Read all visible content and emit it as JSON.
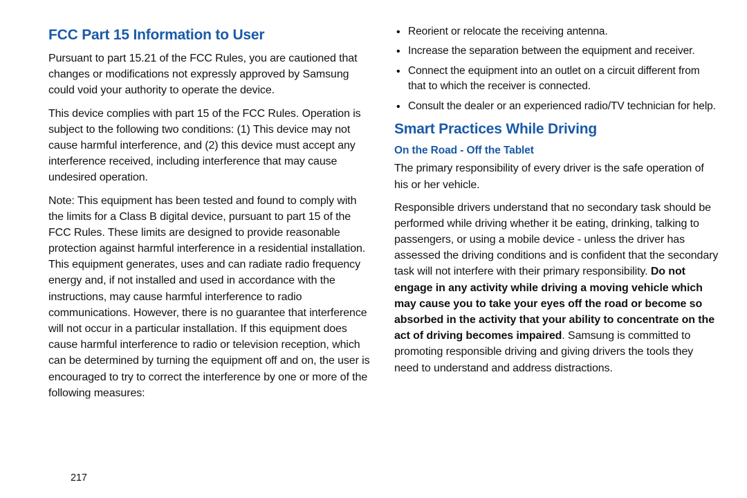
{
  "left": {
    "heading": "FCC Part 15 Information to User",
    "p1": "Pursuant to part 15.21 of the FCC Rules, you are cautioned that changes or modifications not expressly approved by Samsung could void your authority to operate the device.",
    "p2": "This device complies with part 15 of the FCC Rules. Operation is subject to the following two conditions: (1) This device may not cause harmful interference, and (2) this device must accept any interference received, including interference that may cause undesired operation.",
    "p3": "Note: This equipment has been tested and found to comply with the limits for a Class B digital device, pursuant to part 15 of the FCC Rules. These limits are designed to provide reasonable protection against harmful interference in a residential installation. This equipment generates, uses and can radiate radio frequency energy and, if not installed and used in accordance with the instructions, may cause harmful interference to radio communications. However, there is no guarantee that interference will not occur in a particular installation. If this equipment does cause harmful interference to radio or television reception, which can be determined by turning the equipment off and on, the user is encouraged to try to correct the interference by one or more of the following measures:"
  },
  "right": {
    "bullets": [
      "Reorient or relocate the receiving antenna.",
      "Increase the separation between the equipment and receiver.",
      "Connect the equipment into an outlet on a circuit different from that to which the receiver is connected.",
      "Consult the dealer or an experienced radio/TV technician for help."
    ],
    "heading2": "Smart Practices While Driving",
    "subheading": "On the Road - Off the Tablet",
    "p_primary": "The primary responsibility of every driver is the safe operation of his or her vehicle.",
    "p_resp_pre": "Responsible drivers understand that no secondary task should be performed while driving whether it be eating, drinking, talking to passengers, or using a mobile device - unless the driver has assessed the driving conditions and is confident that the secondary task will not interfere with their primary responsibility. ",
    "p_resp_bold": "Do not engage in any activity while driving a moving vehicle which may cause you to take your eyes off the road or become so absorbed in the activity that your ability to concentrate on the act of driving becomes impaired",
    "p_resp_post": ". Samsung is committed to promoting responsible driving and giving drivers the tools they need to understand and address distractions."
  },
  "page_number": "217"
}
